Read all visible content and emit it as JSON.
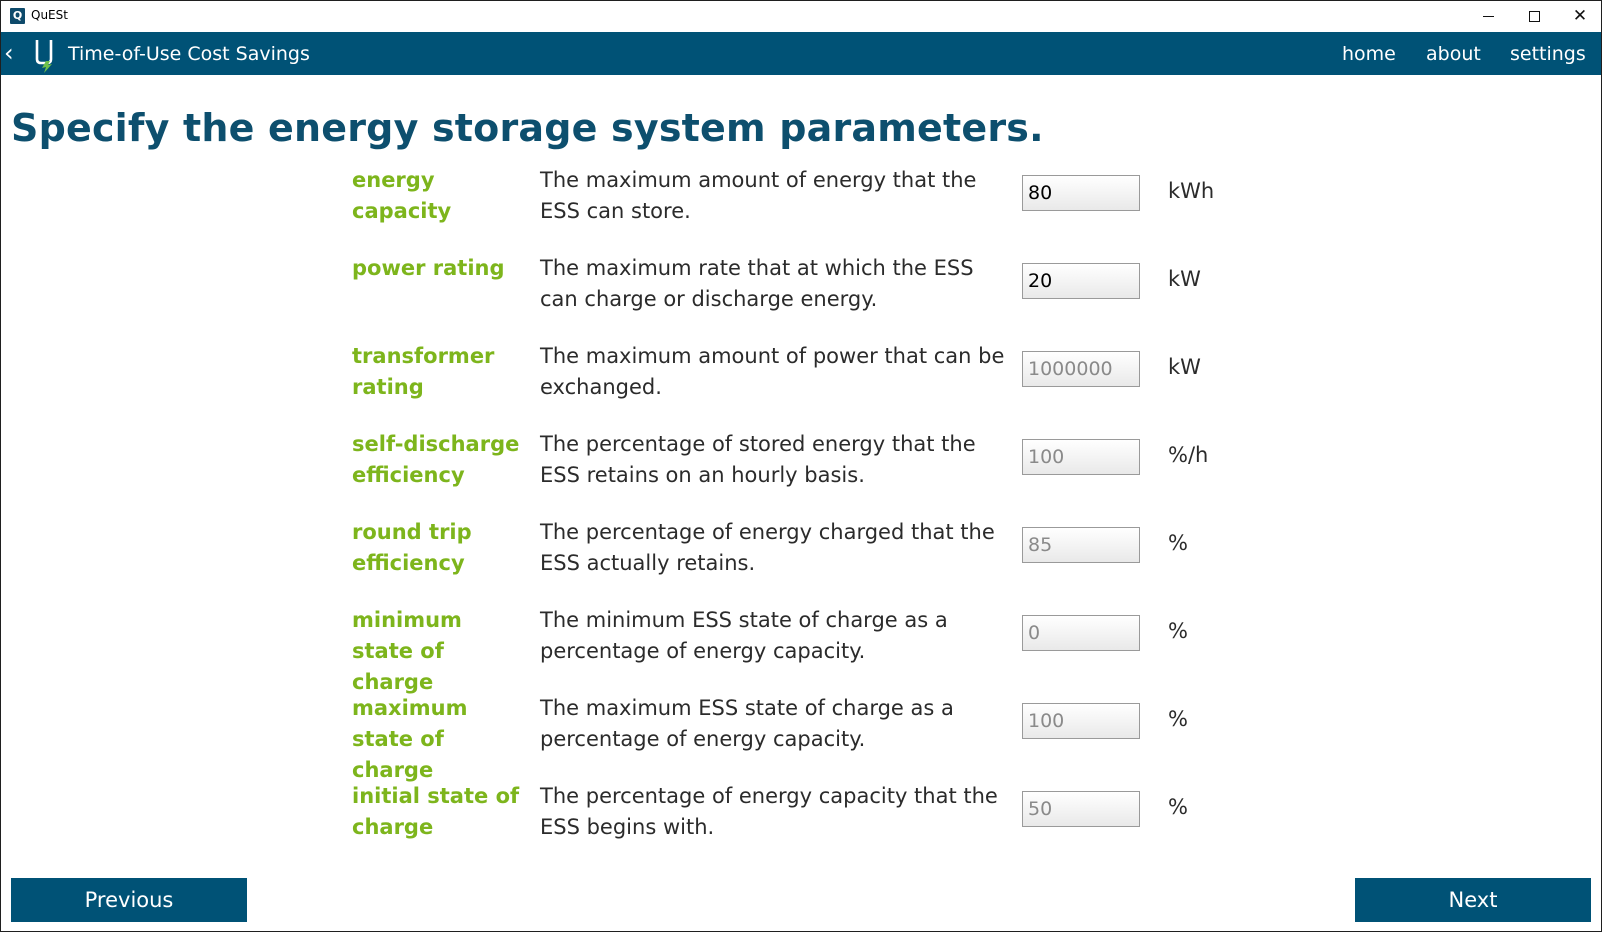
{
  "window": {
    "title": "QuESt",
    "icon_letter": "Q"
  },
  "navbar": {
    "back_glyph": "‹",
    "title": "Time-of-Use Cost Savings",
    "links": {
      "home": "home",
      "about": "about",
      "settings": "settings"
    }
  },
  "main": {
    "heading": "Specify the energy storage system parameters.",
    "params": [
      {
        "label": "energy capacity",
        "description": "The maximum amount of energy that the ESS can store.",
        "value": "80",
        "unit": "kWh",
        "enabled": true
      },
      {
        "label": "power rating",
        "description": "The maximum rate that at which the ESS can charge or discharge energy.",
        "value": "20",
        "unit": "kW",
        "enabled": true
      },
      {
        "label": "transformer rating",
        "description": "The maximum amount of power that can be exchanged.",
        "value": "1000000",
        "unit": "kW",
        "enabled": false
      },
      {
        "label": "self-discharge efficiency",
        "description": "The percentage of stored energy that the ESS retains on an hourly basis.",
        "value": "100",
        "unit": "%/h",
        "enabled": false
      },
      {
        "label": "round trip efficiency",
        "description": "The percentage of energy charged that the ESS actually retains.",
        "value": "85",
        "unit": "%",
        "enabled": false
      },
      {
        "label": "minimum state of charge",
        "description": "The minimum ESS state of charge as a percentage of energy capacity.",
        "value": "0",
        "unit": "%",
        "enabled": false
      },
      {
        "label": "maximum state of charge",
        "description": "The maximum ESS state of charge as a percentage of energy capacity.",
        "value": "100",
        "unit": "%",
        "enabled": false
      },
      {
        "label": "initial state of charge",
        "description": "The percentage of energy capacity that the ESS begins with.",
        "value": "50",
        "unit": "%",
        "enabled": false
      }
    ]
  },
  "footer": {
    "previous_label": "Previous",
    "next_label": "Next"
  },
  "colors": {
    "primary": "#005276",
    "heading": "#0d4f6e",
    "label_green": "#7db51c",
    "logo_green": "#6cc04a"
  }
}
